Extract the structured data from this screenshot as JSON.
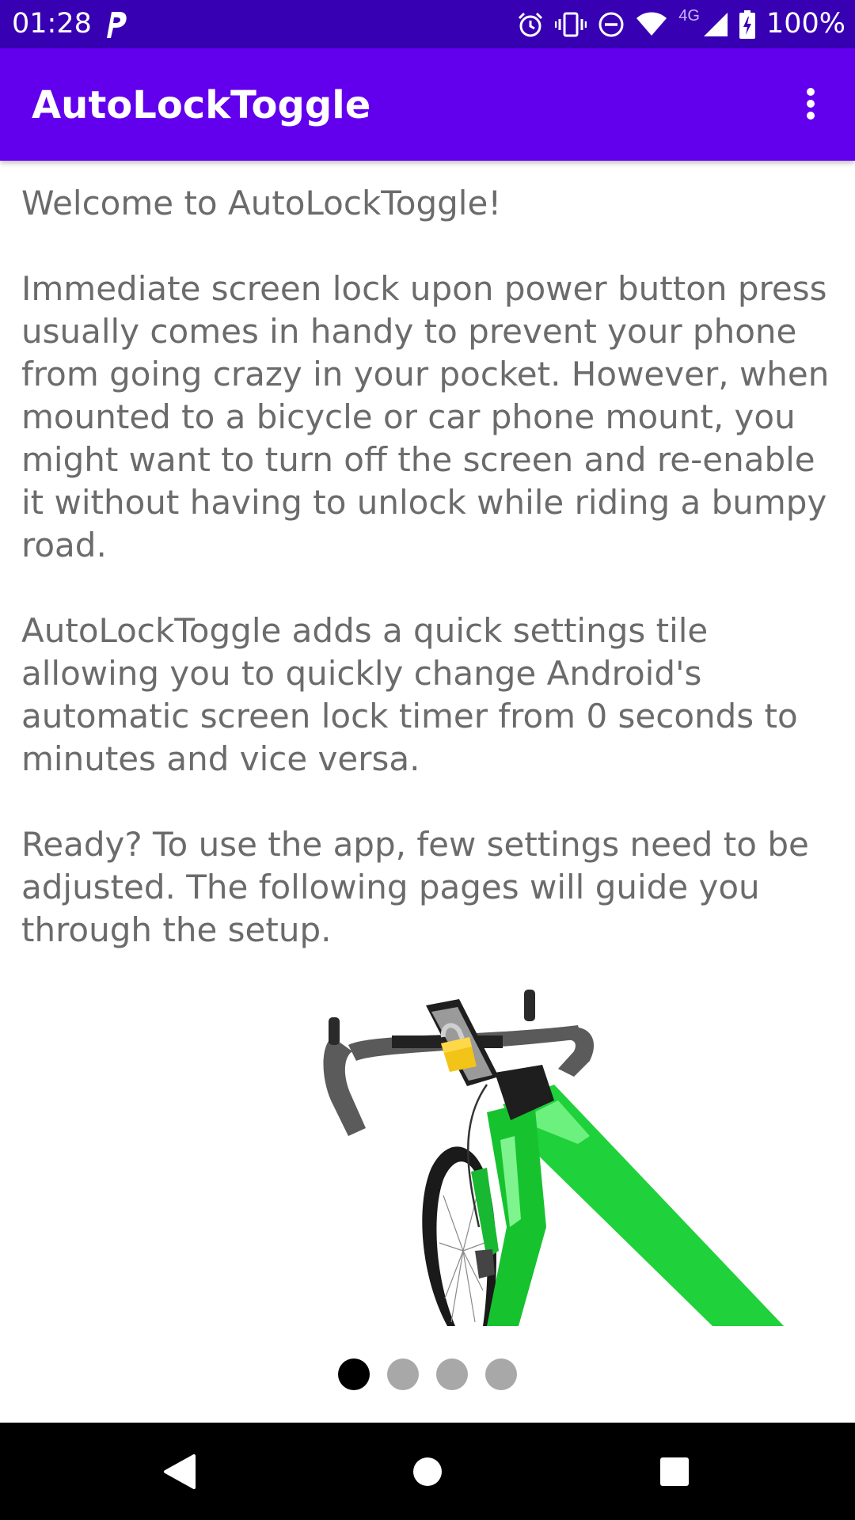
{
  "status_bar": {
    "time": "01:28",
    "network_label": "4G",
    "battery_percent": "100%",
    "icons": [
      "parking-icon",
      "alarm-icon",
      "vibrate-icon",
      "do-not-disturb-icon",
      "wifi-icon",
      "cellular-signal-icon",
      "battery-charging-icon"
    ]
  },
  "app_bar": {
    "title": "AutoLockToggle",
    "menu_icon": "more-vert-icon"
  },
  "content": {
    "welcome": "Welcome to AutoLockToggle!",
    "paragraph_1": "Immediate screen lock upon power button press usually comes in handy to prevent your phone from going crazy in your pocket. However, when mounted to a bicycle or car phone mount, you might want to turn off the screen and re-enable it without having to unlock while riding a bumpy road.",
    "paragraph_2": "AutoLockToggle adds a quick settings tile allowing you to quickly change Android's automatic screen lock timer from 0 seconds to minutes and vice versa.",
    "paragraph_3": "Ready? To use the app, few settings need to be adjusted. The following pages will guide you through the setup."
  },
  "pager": {
    "page_count": 4,
    "current_page": 1
  },
  "nav_bar": {
    "icons": [
      "back-icon",
      "home-icon",
      "recents-icon"
    ]
  },
  "colors": {
    "status_bar": "#3700b3",
    "app_bar": "#6200ee",
    "body_text": "#6b6b6b",
    "dot_active": "#000000",
    "dot_inactive": "#a8a8a8",
    "bike_frame": "#1fd13a",
    "lock_body": "#f2c418"
  }
}
